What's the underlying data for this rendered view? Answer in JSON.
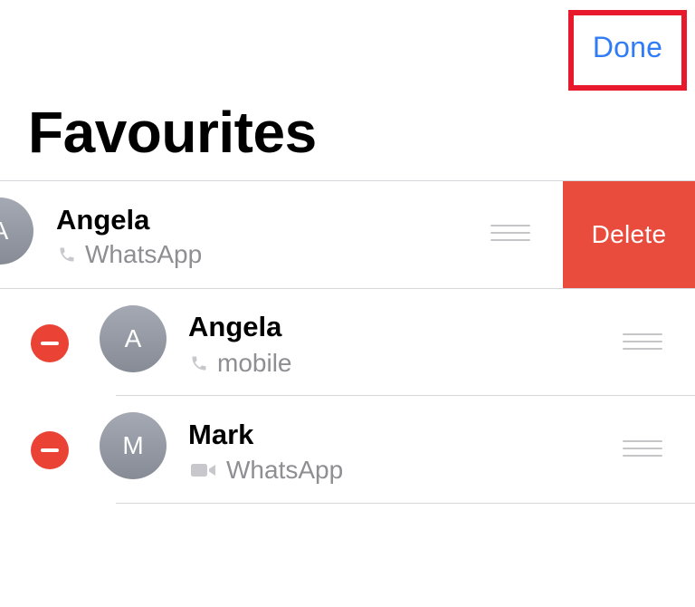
{
  "header": {
    "done_label": "Done",
    "title": "Favourites"
  },
  "swiped_row": {
    "avatar_initial": "A",
    "name": "Angela",
    "subtitle": "WhatsApp",
    "subtitle_icon": "phone-icon",
    "delete_label": "Delete"
  },
  "favourites": [
    {
      "avatar_initial": "A",
      "name": "Angela",
      "subtitle": "mobile",
      "subtitle_icon": "phone-icon"
    },
    {
      "avatar_initial": "M",
      "name": "Mark",
      "subtitle": "WhatsApp",
      "subtitle_icon": "video-icon"
    }
  ],
  "colors": {
    "accent": "#2f7cf6",
    "delete": "#e94c3d",
    "remove_control": "#ea4335",
    "highlight_box": "#e8192c",
    "secondary_text": "#8e8e93"
  }
}
